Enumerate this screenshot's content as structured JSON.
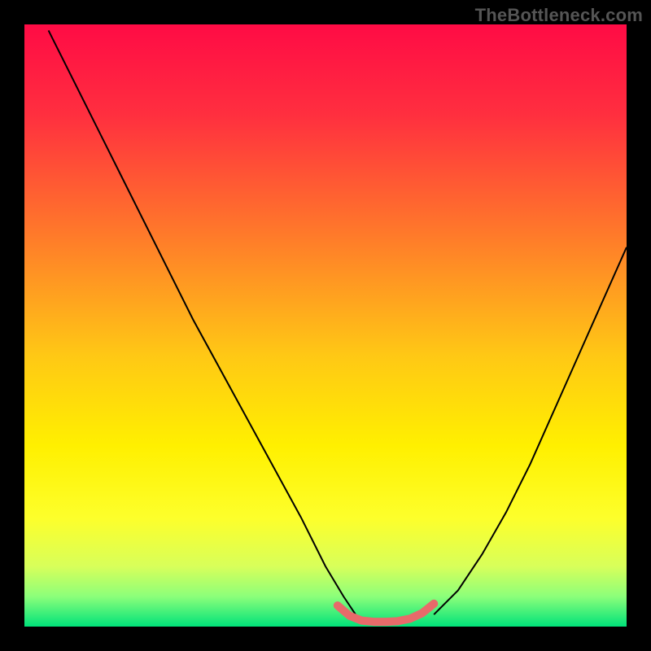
{
  "watermark": "TheBottleneck.com",
  "chart_data": {
    "type": "line",
    "title": "",
    "xlabel": "",
    "ylabel": "",
    "xlim": [
      0,
      100
    ],
    "ylim": [
      0,
      100
    ],
    "background_gradient": {
      "stops": [
        {
          "offset": 0.0,
          "color": "#ff0b45"
        },
        {
          "offset": 0.15,
          "color": "#ff2f3f"
        },
        {
          "offset": 0.35,
          "color": "#ff7a2a"
        },
        {
          "offset": 0.55,
          "color": "#ffc815"
        },
        {
          "offset": 0.7,
          "color": "#fff000"
        },
        {
          "offset": 0.82,
          "color": "#fdff2b"
        },
        {
          "offset": 0.9,
          "color": "#d8ff5a"
        },
        {
          "offset": 0.95,
          "color": "#8cff7a"
        },
        {
          "offset": 1.0,
          "color": "#00e27a"
        }
      ]
    },
    "series": [
      {
        "name": "bottleneck-curve-left",
        "color": "#000000",
        "width": 2,
        "x": [
          4,
          10,
          16,
          22,
          28,
          34,
          40,
          46,
          50,
          53,
          55
        ],
        "y": [
          99,
          87,
          75,
          63,
          51,
          40,
          29,
          18,
          10,
          5,
          2
        ]
      },
      {
        "name": "bottleneck-curve-right",
        "color": "#000000",
        "width": 2,
        "x": [
          68,
          72,
          76,
          80,
          84,
          88,
          92,
          96,
          100
        ],
        "y": [
          2,
          6,
          12,
          19,
          27,
          36,
          45,
          54,
          63
        ]
      },
      {
        "name": "optimal-band",
        "color": "#e86a6a",
        "width": 10,
        "linecap": "round",
        "x": [
          52,
          54,
          56,
          58,
          60,
          62,
          64,
          66,
          68
        ],
        "y": [
          3.5,
          1.8,
          1.0,
          0.8,
          0.8,
          0.9,
          1.3,
          2.2,
          3.8
        ]
      }
    ],
    "markers": [
      {
        "name": "optimal-point",
        "x": 68,
        "y": 3.8,
        "r": 5,
        "color": "#e86a6a"
      }
    ]
  }
}
